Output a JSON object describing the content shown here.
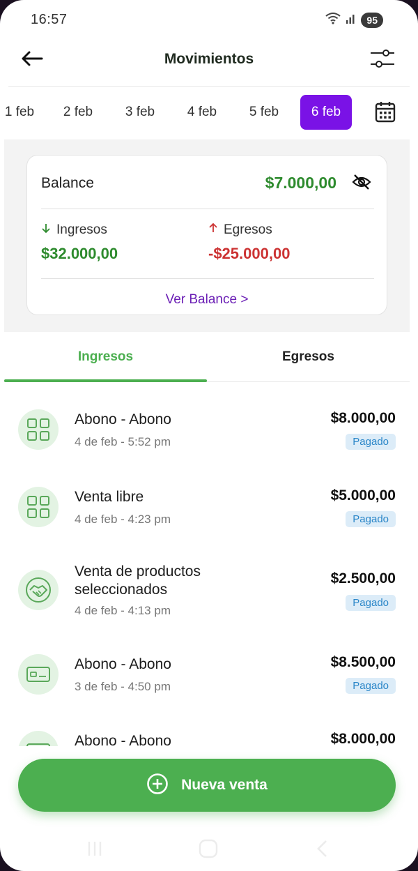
{
  "status_bar": {
    "time": "16:57",
    "battery": "95"
  },
  "header": {
    "title": "Movimientos"
  },
  "dates": [
    {
      "label": "1 feb",
      "active": false
    },
    {
      "label": "2 feb",
      "active": false
    },
    {
      "label": "3 feb",
      "active": false
    },
    {
      "label": "4 feb",
      "active": false
    },
    {
      "label": "5 feb",
      "active": false
    },
    {
      "label": "6 feb",
      "active": true
    }
  ],
  "balance": {
    "label": "Balance",
    "value": "$7.000,00",
    "income_label": "Ingresos",
    "income_value": "$32.000,00",
    "expense_label": "Egresos",
    "expense_value": "-$25.000,00",
    "see_balance": "Ver Balance >"
  },
  "tabs": [
    {
      "label": "Ingresos",
      "active": true
    },
    {
      "label": "Egresos",
      "active": false
    }
  ],
  "transactions": [
    {
      "title": "Abono - Abono",
      "date": "4 de feb - 5:52 pm",
      "amount": "$8.000,00",
      "status": "Pagado",
      "icon": "grid-icon"
    },
    {
      "title": "Venta libre",
      "date": "4 de feb - 4:23 pm",
      "amount": "$5.000,00",
      "status": "Pagado",
      "icon": "grid-icon"
    },
    {
      "title": "Venta de productos seleccionados",
      "date": "4 de feb - 4:13 pm",
      "amount": "$2.500,00",
      "status": "Pagado",
      "icon": "handshake-icon"
    },
    {
      "title": "Abono - Abono",
      "date": "3 de feb - 4:50 pm",
      "amount": "$8.500,00",
      "status": "Pagado",
      "icon": "cash-icon"
    },
    {
      "title": "Abono - Abono",
      "date": "",
      "amount": "$8.000,00",
      "status": "",
      "icon": "cash-icon"
    }
  ],
  "cta": {
    "label": "Nueva venta"
  },
  "colors": {
    "accent": "#4caf50",
    "purple": "#7a12e6",
    "income": "#2e8b2e",
    "expense": "#cc3333",
    "badge_bg": "#dcecf8",
    "badge_text": "#2a86c8"
  }
}
